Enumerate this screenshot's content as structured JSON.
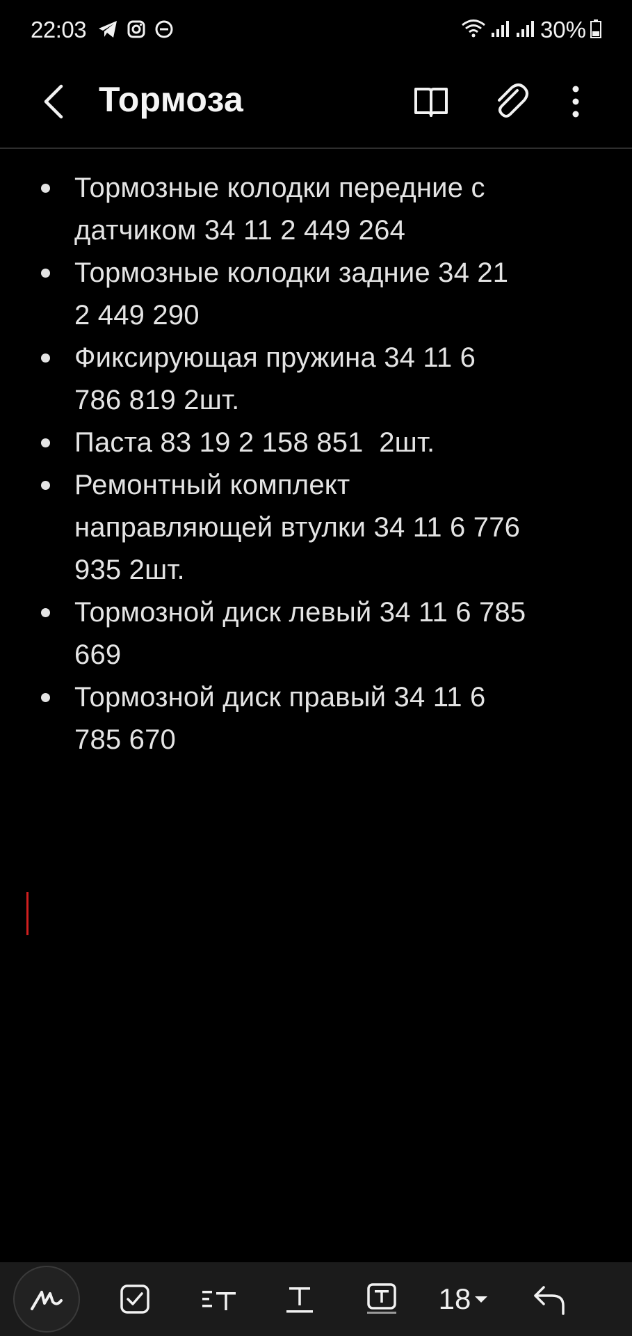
{
  "status": {
    "time": "22:03",
    "battery": "30%"
  },
  "header": {
    "title": "Тормоза"
  },
  "note": {
    "items": [
      {
        "lines": [
          "Тормозные колодки передние с",
          "датчиком 34 11 2 449 264"
        ]
      },
      {
        "lines": [
          "Тормозные колодки задние 34 21",
          "2 449 290"
        ]
      },
      {
        "lines": [
          "Фиксирующая пружина 34 11 6",
          "786 819 2шт."
        ]
      },
      {
        "lines": [
          "Паста 83 19 2 158 851  2шт."
        ]
      },
      {
        "lines": [
          "Ремонтный комплект",
          "направляющей втулки 34 11 6 776",
          "935 2шт."
        ]
      },
      {
        "lines": [
          "Тормозной диск левый 34 11 6 785",
          "669"
        ]
      },
      {
        "lines": [
          "Тормозной диск правый 34 11 6",
          "785 670"
        ]
      }
    ]
  },
  "toolbar": {
    "font_size": "18"
  },
  "colors": {
    "background": "#000000",
    "text": "#e4e4e4",
    "cursor": "#d11f1f",
    "toolbar": "#1b1b1b"
  },
  "icons": [
    "telegram-icon",
    "instagram-icon",
    "dnd-icon",
    "wifi-icon",
    "signal-icon",
    "battery-icon",
    "back-arrow-icon",
    "book-icon",
    "paperclip-icon",
    "more-vertical-icon",
    "pen-icon",
    "checkbox-icon",
    "paragraph-style-icon",
    "text-format-icon",
    "text-box-icon",
    "chevron-down-icon",
    "undo-icon"
  ]
}
